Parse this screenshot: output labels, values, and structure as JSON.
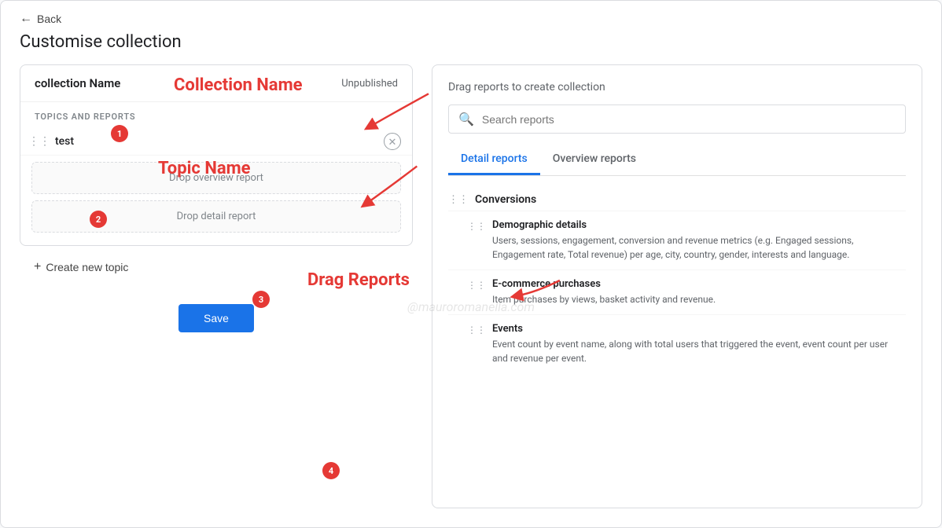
{
  "back_button": "Back",
  "page_title": "Customise collection",
  "collection": {
    "name": "collection Name",
    "status": "Unpublished",
    "topics_label": "TOPICS AND REPORTS",
    "topic_name": "test",
    "drop_overview": "Drop overview report",
    "drop_detail": "Drop detail report",
    "create_topic": "Create new topic",
    "save": "Save"
  },
  "right_panel": {
    "drag_title": "Drag reports to create collection",
    "search_placeholder": "Search reports",
    "tabs": [
      {
        "label": "Detail reports",
        "active": true
      },
      {
        "label": "Overview reports",
        "active": false
      }
    ],
    "sections": [
      {
        "name": "Conversions",
        "items": []
      }
    ],
    "reports": [
      {
        "name": "Demographic details",
        "desc": "Users, sessions, engagement, conversion and revenue metrics (e.g. Engaged sessions, Engagement rate, Total revenue) per age, city, country, gender, interests and language."
      },
      {
        "name": "E-commerce purchases",
        "desc": "Item purchases by views, basket activity and revenue."
      },
      {
        "name": "Events",
        "desc": "Event count by event name, along with total users that triggered the event, event count per user and revenue per event."
      }
    ]
  },
  "annotations": {
    "collection_name_label": "Collection Name",
    "topic_name_label": "Topic Name",
    "drag_reports_label": "Drag Reports"
  }
}
